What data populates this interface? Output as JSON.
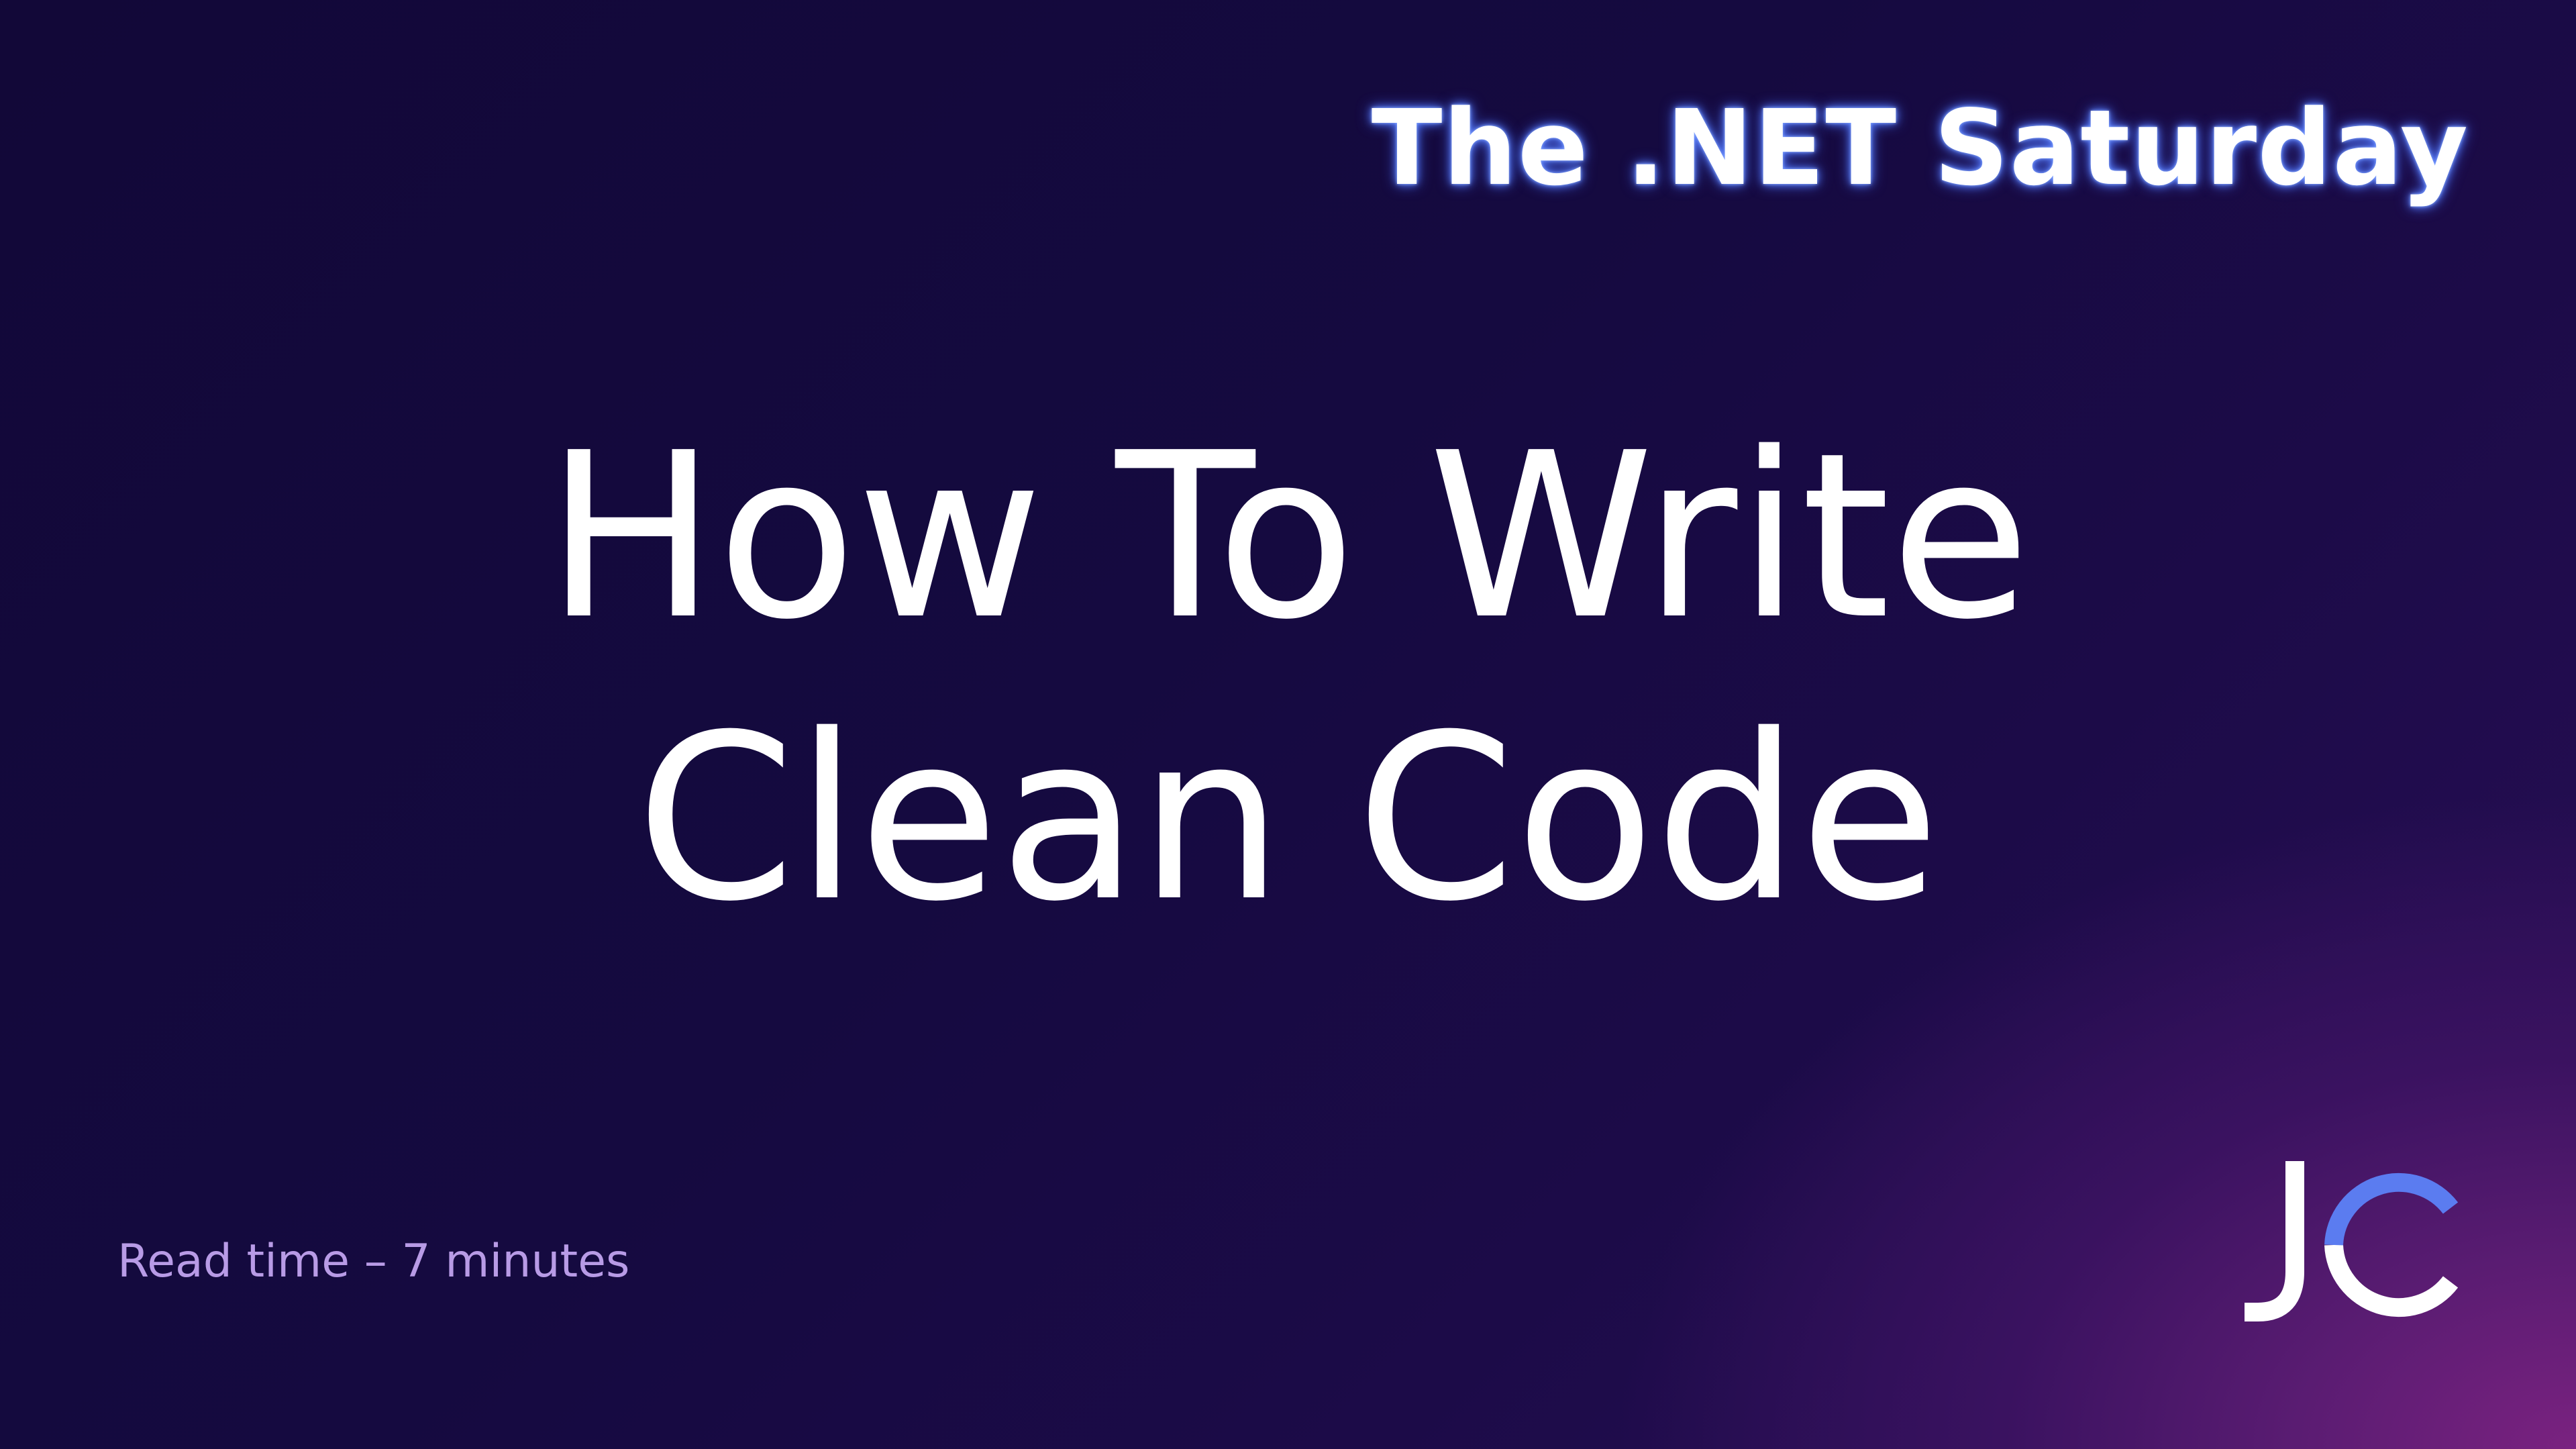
{
  "brand": {
    "title": "The .NET Saturday"
  },
  "headline": {
    "line1": "How To Write",
    "line2": "Clean Code"
  },
  "footer": {
    "read_time": "Read time – 7 minutes"
  },
  "logo": {
    "letters": "JC",
    "primary_color": "#ffffff",
    "accent_color": "#5b7cf0"
  },
  "colors": {
    "background_dark": "#140a3c",
    "background_accent": "#7a2280",
    "read_time_text": "#b89be6",
    "title_glow": "#5d82ff"
  }
}
